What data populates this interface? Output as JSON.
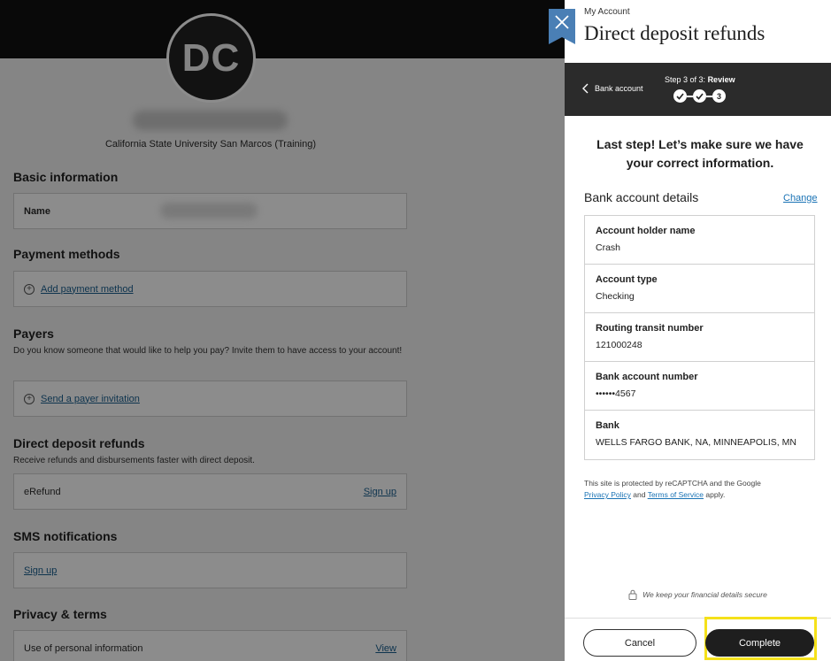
{
  "background": {
    "avatar_initials": "DC",
    "school": "California State University San Marcos (Training)",
    "basic_info": {
      "title": "Basic information",
      "name_label": "Name"
    },
    "payment_methods": {
      "title": "Payment methods",
      "add_label": "Add payment method"
    },
    "payers": {
      "title": "Payers",
      "description": "Do you know someone that would like to help you pay? Invite them to have access to your account!",
      "invite_label": "Send a payer invitation"
    },
    "direct_deposit": {
      "title": "Direct deposit refunds",
      "description": "Receive refunds and disbursements faster with direct deposit.",
      "item_label": "eRefund",
      "signup_label": "Sign up"
    },
    "sms": {
      "title": "SMS notifications",
      "signup_label": "Sign up"
    },
    "privacy": {
      "title": "Privacy & terms",
      "item_label": "Use of personal information",
      "view_label": "View"
    }
  },
  "panel": {
    "eyebrow": "My Account",
    "title": "Direct deposit refunds",
    "back_label": "Bank account",
    "step_prefix": "Step 3 of 3:",
    "step_name": "Review",
    "step_current": "3",
    "lead": "Last step! Let’s make sure we have your correct information.",
    "details_title": "Bank account details",
    "change_label": "Change",
    "rows": [
      {
        "label": "Account holder name",
        "value": "Crash"
      },
      {
        "label": "Account type",
        "value": "Checking"
      },
      {
        "label": "Routing transit number",
        "value": "121000248"
      },
      {
        "label": "Bank account number",
        "value": "••••••4567"
      },
      {
        "label": "Bank",
        "value": "WELLS FARGO BANK, NA, MINNEAPOLIS, MN"
      }
    ],
    "recaptcha": {
      "text1": "This site is protected by reCAPTCHA and the Google",
      "privacy": "Privacy Policy",
      "and": "and",
      "terms": "Terms of Service",
      "apply": "apply."
    },
    "secure_note": "We keep your financial details secure",
    "cancel_label": "Cancel",
    "complete_label": "Complete"
  },
  "colors": {
    "accent": "#4a7fb5",
    "link": "#1a73b5",
    "highlight": "#f5e11a",
    "primary_button": "#1e1e1e"
  },
  "icons": {
    "close": "close-icon",
    "back": "chevron-left-icon",
    "check": "check-icon",
    "lock": "lock-icon",
    "plus": "plus-circle-icon"
  }
}
